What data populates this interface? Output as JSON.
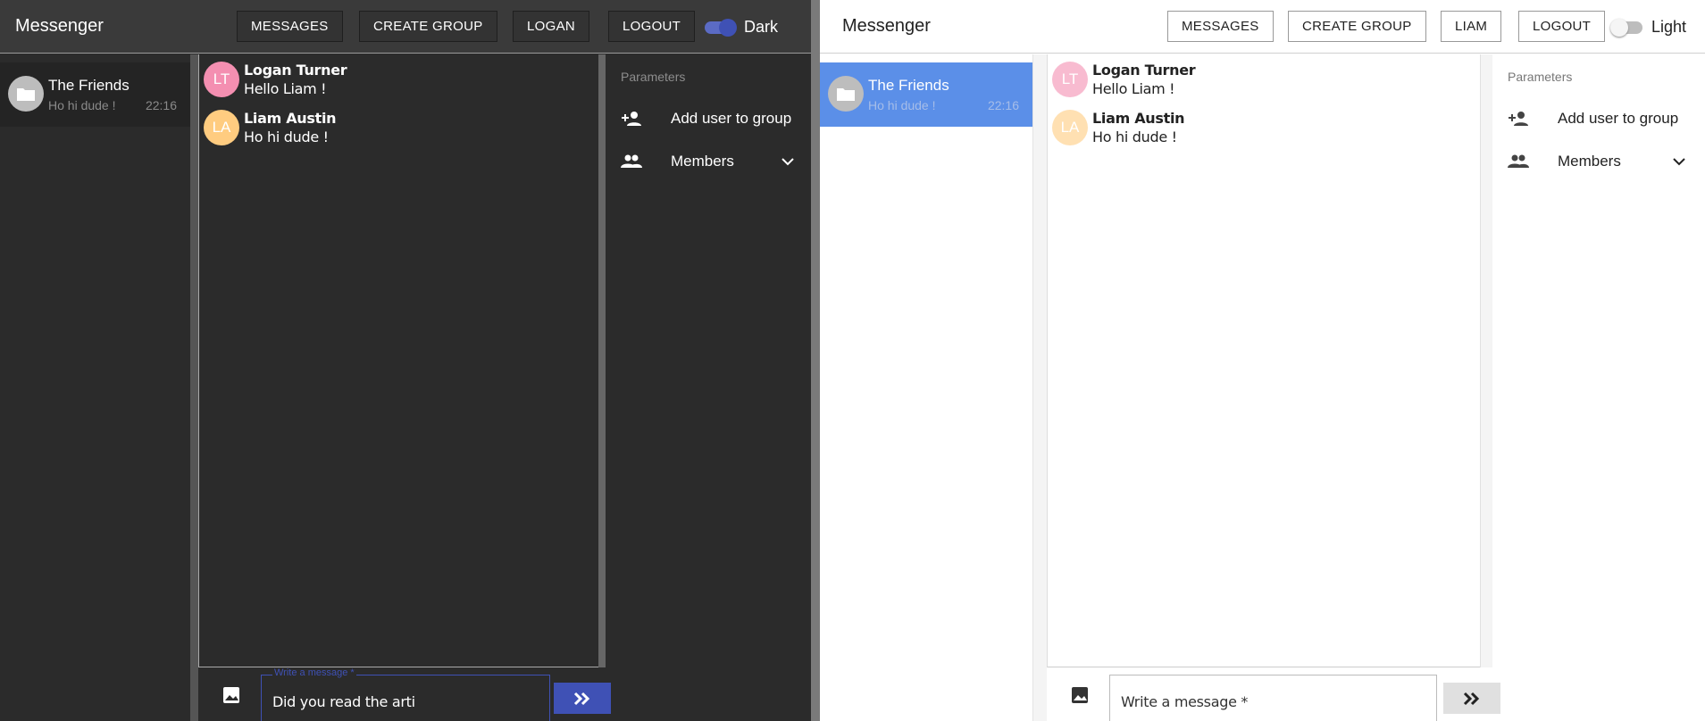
{
  "dark": {
    "app_title": "Messenger",
    "nav": [
      "MESSAGES",
      "CREATE GROUP",
      "LOGAN",
      "LOGOUT"
    ],
    "theme_label": "Dark",
    "theme_on": true,
    "conversation": {
      "name": "The Friends",
      "preview": "Ho hi dude !",
      "time": "22:16"
    },
    "messages": [
      {
        "initials": "LT",
        "author": "Logan Turner",
        "text": "Hello Liam !",
        "avatar_color": "#f48fb1"
      },
      {
        "initials": "LA",
        "author": "Liam Austin",
        "text": "Ho hi dude !",
        "avatar_color": "#ffcc80"
      }
    ],
    "params": {
      "title": "Parameters",
      "add_user": "Add user to group",
      "members": "Members"
    },
    "composer": {
      "label": "Write a message *",
      "value": "Did you read the arti"
    }
  },
  "light": {
    "app_title": "Messenger",
    "nav": [
      "MESSAGES",
      "CREATE GROUP",
      "LIAM",
      "LOGOUT"
    ],
    "theme_label": "Light",
    "theme_on": false,
    "conversation": {
      "name": "The Friends",
      "preview": "Ho hi dude !",
      "time": "22:16"
    },
    "messages": [
      {
        "initials": "LT",
        "author": "Logan Turner",
        "text": "Hello Liam !",
        "avatar_color": "#f8bbd0"
      },
      {
        "initials": "LA",
        "author": "Liam Austin",
        "text": "Ho hi dude !",
        "avatar_color": "#ffe0b2"
      }
    ],
    "params": {
      "title": "Parameters",
      "add_user": "Add user to group",
      "members": "Members"
    },
    "composer": {
      "placeholder": "Write a message *"
    }
  }
}
